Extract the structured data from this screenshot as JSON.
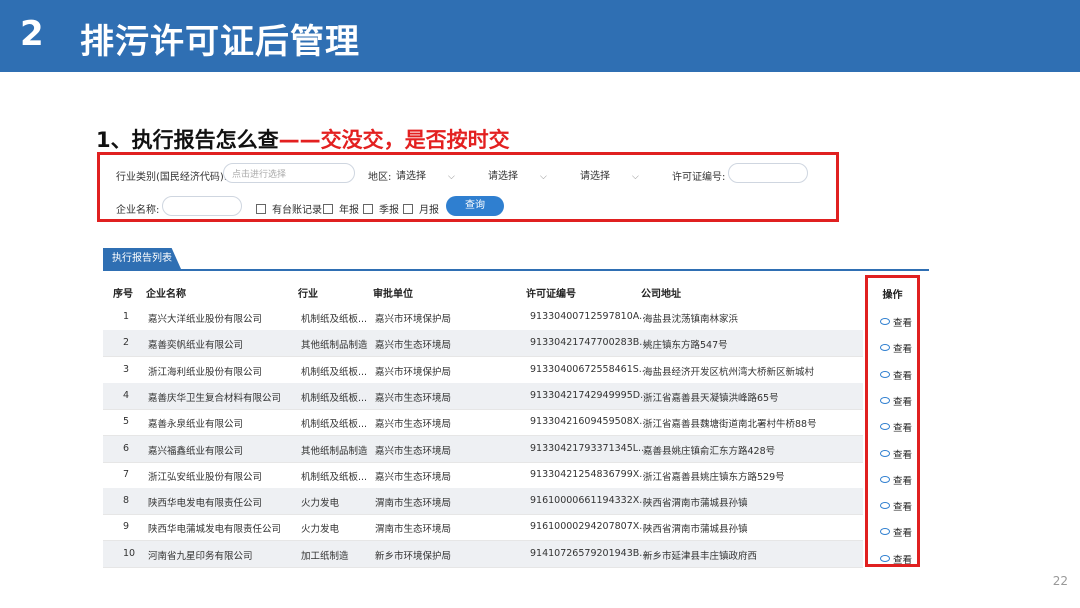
{
  "banner": {
    "number": "2",
    "title": "排污许可证后管理"
  },
  "subtitle": {
    "main": "1、执行报告怎么查",
    "dash": "——",
    "highlight": "交没交，是否按时交"
  },
  "filter": {
    "industry_label": "行业类别(国民经济代码):",
    "industry_placeholder": "点击进行选择",
    "region_label": "地区:",
    "select1": "请选择",
    "select2": "请选择",
    "select3": "请选择",
    "permit_label": "许可证编号:",
    "permit_value": "",
    "company_label": "企业名称:",
    "company_value": "",
    "check1": "有台账记录",
    "check2": "年报",
    "check3": "季报",
    "check4": "月报",
    "query_button": "查询"
  },
  "list": {
    "tab": "执行报告列表",
    "headers": {
      "seq": "序号",
      "company": "企业名称",
      "industry": "行业",
      "approver": "审批单位",
      "permit": "许可证编号",
      "address": "公司地址",
      "action": "操作"
    },
    "rows": [
      {
        "seq": "1",
        "company": "嘉兴大洋纸业股份有限公司",
        "industry": "机制纸及纸板...",
        "approver": "嘉兴市环境保护局",
        "permit": "91330400712597810A...",
        "address": "海盐县沈荡镇南林家浜"
      },
      {
        "seq": "2",
        "company": "嘉善奕帆纸业有限公司",
        "industry": "其他纸制品制造",
        "approver": "嘉兴市生态环境局",
        "permit": "91330421747700283B...",
        "address": "姚庄镇东方路547号"
      },
      {
        "seq": "3",
        "company": "浙江海利纸业股份有限公司",
        "industry": "机制纸及纸板...",
        "approver": "嘉兴市环境保护局",
        "permit": "91330400672558461S...",
        "address": "海盐县经济开发区杭州湾大桥新区新城村"
      },
      {
        "seq": "4",
        "company": "嘉善庆华卫生复合材料有限公司",
        "industry": "机制纸及纸板...",
        "approver": "嘉兴市生态环境局",
        "permit": "91330421742949995D...",
        "address": "浙江省嘉善县天凝镇洪峰路65号"
      },
      {
        "seq": "5",
        "company": "嘉善永泉纸业有限公司",
        "industry": "机制纸及纸板...",
        "approver": "嘉兴市生态环境局",
        "permit": "91330421609459508X...",
        "address": "浙江省嘉善县魏塘街道南北署村牛桥88号"
      },
      {
        "seq": "6",
        "company": "嘉兴福鑫纸业有限公司",
        "industry": "其他纸制品制造",
        "approver": "嘉兴市生态环境局",
        "permit": "91330421793371345L...",
        "address": "嘉善县姚庄镇俞汇东方路428号"
      },
      {
        "seq": "7",
        "company": "浙江弘安纸业股份有限公司",
        "industry": "机制纸及纸板...",
        "approver": "嘉兴市生态环境局",
        "permit": "91330421254836799X...",
        "address": "浙江省嘉善县姚庄镇东方路529号"
      },
      {
        "seq": "8",
        "company": "陕西华电发电有限责任公司",
        "industry": "火力发电",
        "approver": "渭南市生态环境局",
        "permit": "91610000661194332X...",
        "address": "陕西省渭南市蒲城县孙镇"
      },
      {
        "seq": "9",
        "company": "陕西华电蒲城发电有限责任公司",
        "industry": "火力发电",
        "approver": "渭南市生态环境局",
        "permit": "91610000294207807X...",
        "address": "陕西省渭南市蒲城县孙镇"
      },
      {
        "seq": "10",
        "company": "河南省九星印务有限公司",
        "industry": "加工纸制造",
        "approver": "新乡市环境保护局",
        "permit": "91410726579201943B...",
        "address": "新乡市延津县丰庄镇政府西"
      }
    ],
    "action_label": "查看"
  },
  "page_number": "22"
}
